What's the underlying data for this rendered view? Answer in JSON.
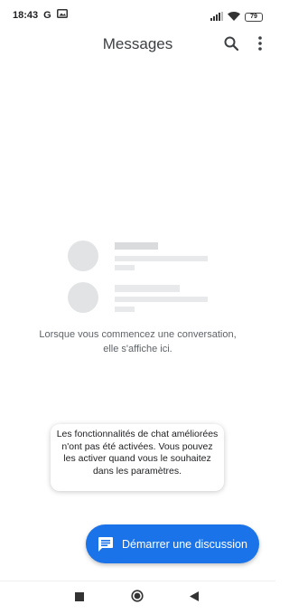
{
  "status_bar": {
    "time": "18:43",
    "google_indicator": "G",
    "battery_level": "79",
    "icons": [
      "photo-icon",
      "signal-icon",
      "wifi-icon",
      "battery-icon"
    ]
  },
  "app_bar": {
    "title": "Messages",
    "icons": [
      "search-icon",
      "more-vert-icon"
    ]
  },
  "empty_state": {
    "message": "Lorsque vous commencez une conversation, elle s'affiche ici."
  },
  "toast": {
    "message": "Les fonctionnalités de chat améliorées n'ont pas été activées. Vous pouvez les activer quand vous le souhaitez dans les paramètres."
  },
  "fab": {
    "label": "Démarrer une discussion",
    "icon": "chat-icon",
    "color": "#1a73e8"
  },
  "nav_bar": {
    "icons": [
      "recents-icon",
      "home-icon",
      "back-icon"
    ]
  }
}
